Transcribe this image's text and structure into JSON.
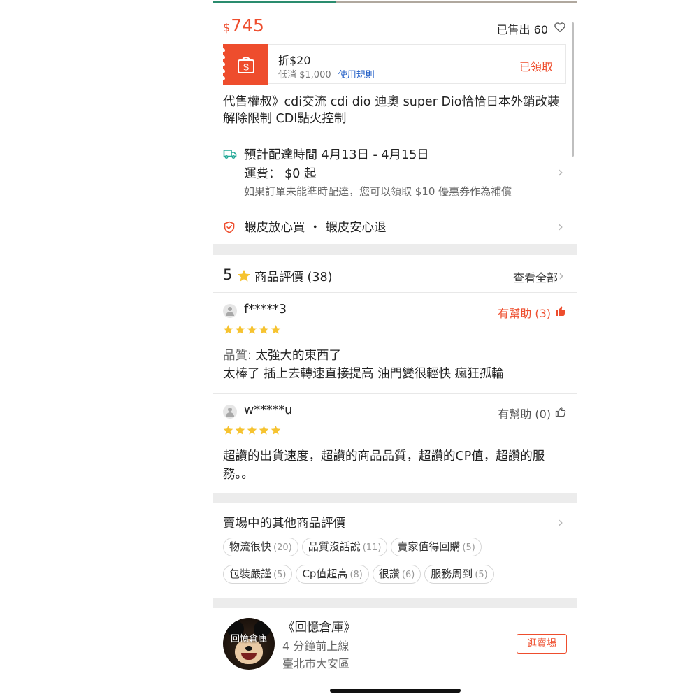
{
  "colors": {
    "accent": "#ee4d2d",
    "link": "#1f5cc6",
    "star": "#f6c330",
    "divider": "#e8e8e8",
    "section_gap": "#ececec"
  },
  "price": {
    "currency": "$",
    "amount": "745"
  },
  "sold_label": "已售出 60",
  "voucher": {
    "icon": "shopee-bag-icon",
    "title": "折$20",
    "min_spend": "低消 $1,000",
    "rules_link": "使用規則",
    "status": "已領取"
  },
  "product_title": "代售權叔》cdi交流 cdi dio 迪奧 super Dio恰恰日本外銷改裝解除限制 CDI點火控制",
  "shipping": {
    "icon": "truck-icon",
    "eta": "預計配達時間 4月13日 - 4月15日",
    "fee": "運費：  $0 起",
    "note": "如果訂單未能準時配達，您可以領取 $10 優惠券作為補償"
  },
  "guarantee": {
    "icon": "shield-check-icon",
    "text": "蝦皮放心買 ・ 蝦皮安心退"
  },
  "ratings": {
    "score": "5",
    "label": "商品評價 (38)",
    "see_all": "查看全部",
    "reviews": [
      {
        "user": "f*****3",
        "helpful": "有幫助 (3)",
        "helpful_active": true,
        "stars": 5,
        "lines": [
          "品質: 太強大的東西了",
          "太棒了 插上去轉速直接提高 油門變很輕快 瘋狂孤輪"
        ],
        "quality_key": "品質:",
        "quality_value": " 太強大的東西了",
        "body": "太棒了 插上去轉速直接提高 油門變很輕快 瘋狂孤輪"
      },
      {
        "user": "w*****u",
        "helpful": "有幫助 (0)",
        "helpful_active": false,
        "stars": 5,
        "body": "超讚的出貨速度，超讚的商品品質，超讚的CP值，超讚的服務。。"
      }
    ]
  },
  "other_reviews": {
    "title": "賣場中的其他商品評價",
    "tags": [
      {
        "label": "物流很快",
        "count": "(20)"
      },
      {
        "label": "品質沒話說",
        "count": "(11)"
      },
      {
        "label": "賣家值得回購",
        "count": "(5)"
      },
      {
        "label": "包裝嚴謹",
        "count": "(5)"
      },
      {
        "label": "Cp值超高",
        "count": "(8)"
      },
      {
        "label": "很讚",
        "count": "(6)"
      },
      {
        "label": "服務周到",
        "count": "(5)"
      }
    ]
  },
  "shop": {
    "avatar_text": "回憶倉庫",
    "name": "《回憶倉庫》",
    "online": "4 分鐘前上線",
    "location": "臺北市大安區",
    "visit_button": "逛賣場"
  }
}
